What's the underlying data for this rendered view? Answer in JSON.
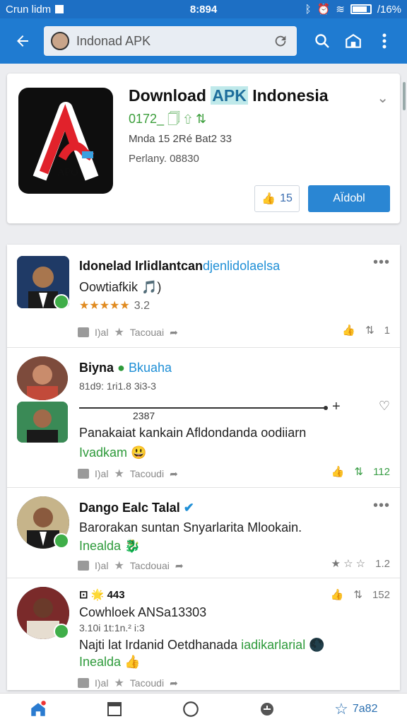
{
  "status_bar": {
    "carrier": "Crun lidm",
    "time": "8:894",
    "battery": "/16%"
  },
  "toolbar": {
    "search_text": "Indonad APK"
  },
  "app": {
    "title_pre": "Download ",
    "title_hl": "APK",
    "title_post": " Indonesia",
    "version": "0172_ 🗍 ⇧ ⇅",
    "meta1": "Mnda 15 2Ré Bat2 33",
    "meta2": "Perlany. 08830",
    "like_count": "15",
    "download_label": "AÏdobl",
    "icon_text": "APO"
  },
  "posts": [
    {
      "name": "Idonelad  Irlidlantcan",
      "link": "djenlidolaelsa",
      "sub": "Oowtiafkik 🎵)",
      "rating": "3.2",
      "action_left": "I)al",
      "action_mid": "Tacouai",
      "right_count": "1"
    },
    {
      "name": "Biyna",
      "link": "Bkuaha",
      "sub": "81d9: 1ri1.8 3i3-3",
      "slider_val": "2387",
      "text": "Panakaiat kankain Afldondanda oodiiarn",
      "tag": "Ivadkam 😃",
      "action_left": "I)al",
      "action_mid": "Tacoudi",
      "right_count": "112"
    },
    {
      "name": "Dango Ealc Talal",
      "text": "Barorakan suntan Snyarlarita Mlookain.",
      "tag": "Inealda 🐉",
      "action_left": "I)al",
      "action_mid": "Tacdouai",
      "right_count": "1.2"
    },
    {
      "name": "⊡ 🌟 443",
      "sub": "Cowhloek ANSa13303",
      "sub2": "3.10i 1t:1n.² i:3",
      "text_pre": "Najti lat Irdanid Oetdhanada ",
      "text_green": "iadikarlarial",
      "tag": "Inealda 👍",
      "action_left": "I)al",
      "action_mid": "Tacoudi",
      "right_count": "152"
    }
  ],
  "bottom_nav": {
    "last_label": "7a82"
  }
}
